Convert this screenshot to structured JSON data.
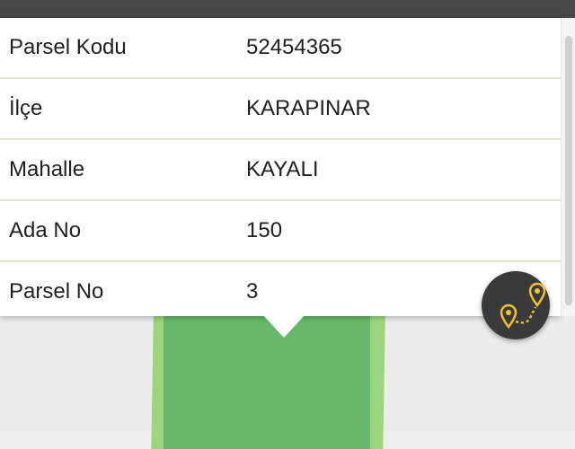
{
  "parcel_info": {
    "rows": [
      {
        "label": "Parsel Kodu",
        "value": "52454365"
      },
      {
        "label": "İlçe",
        "value": "KARAPINAR"
      },
      {
        "label": "Mahalle",
        "value": "KAYALI"
      },
      {
        "label": "Ada No",
        "value": "150"
      },
      {
        "label": "Parsel No",
        "value": "3"
      }
    ]
  },
  "route_button": {
    "icon": "route-pins-icon"
  },
  "colors": {
    "parcel_fill": "#67b86b",
    "parcel_outline": "#9bd67d",
    "button_bg": "#3a3a3a",
    "button_icon": "#f2c230",
    "header_bar": "#474747",
    "row_divider": "#e7e2cf"
  }
}
